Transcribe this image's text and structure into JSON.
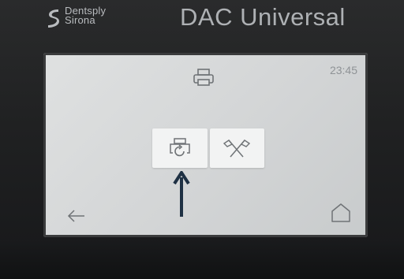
{
  "device": {
    "brand_line1": "Dentsply",
    "brand_line2": "Sirona",
    "model": "DAC Universal"
  },
  "screen": {
    "clock": "23:45"
  },
  "icons": {
    "printer": "printer-icon",
    "reprint": "printer-refresh-icon",
    "flags": "crossed-flags-icon",
    "arrow": "arrow-up-icon",
    "back": "back-arrow-icon",
    "home": "home-icon"
  },
  "colors": {
    "screen_bg": "#d7d9da",
    "button_bg": "#f2f3f3",
    "icon": "#6f7376",
    "arrow": "#1f3144",
    "bezel": "#1f2021"
  }
}
